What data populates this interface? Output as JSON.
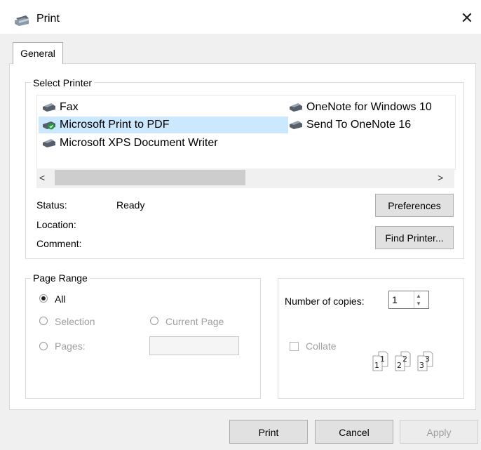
{
  "window": {
    "title": "Print",
    "close_glyph": "✕"
  },
  "tabs": [
    {
      "label": "General"
    }
  ],
  "select_printer": {
    "legend": "Select Printer",
    "printers": [
      {
        "name": "Fax",
        "icon": "fax-icon"
      },
      {
        "name": "Microsoft Print to PDF",
        "icon": "default-printer-icon",
        "selected": true
      },
      {
        "name": "Microsoft XPS Document Writer",
        "icon": "printer-icon"
      },
      {
        "name": "OneNote for Windows 10",
        "icon": "printer-icon"
      },
      {
        "name": "Send To OneNote 16",
        "icon": "printer-icon"
      }
    ],
    "scroll_left": "<",
    "scroll_right": ">",
    "status_label": "Status:",
    "status_value": "Ready",
    "location_label": "Location:",
    "comment_label": "Comment:",
    "preferences_label": "Preferences",
    "find_printer_label": "Find Printer..."
  },
  "page_range": {
    "legend": "Page Range",
    "all_label": "All",
    "selection_label": "Selection",
    "current_page_label": "Current Page",
    "pages_label": "Pages:",
    "pages_value": ""
  },
  "copies": {
    "number_label": "Number of copies:",
    "value": "1",
    "collate_label": "Collate",
    "collate_pages": [
      "1",
      "1",
      "2",
      "2",
      "3",
      "3"
    ]
  },
  "footer": {
    "print_label": "Print",
    "cancel_label": "Cancel",
    "apply_label": "Apply"
  },
  "colors": {
    "selection": "#cce8ff",
    "dialog_bg": "#f0f0f0",
    "button_bg": "#e1e1e1"
  }
}
